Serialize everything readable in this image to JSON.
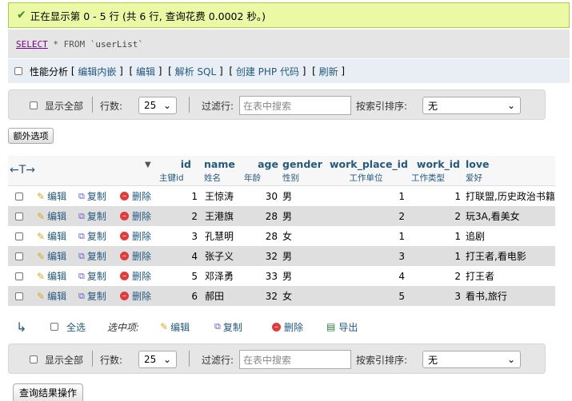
{
  "success": {
    "message": "正在显示第 0 - 5 行 (共 6 行, 查询花费 0.0002 秒。)"
  },
  "sql": {
    "select": "SELECT",
    "star": "*",
    "from": "FROM",
    "table": "`userList`"
  },
  "profiling": {
    "label": "性能分析",
    "links": [
      "编辑内嵌",
      "编辑",
      "解析 SQL",
      "创建 PHP 代码",
      "刷新"
    ]
  },
  "nav": {
    "show_all": "显示全部",
    "rows_label": "行数:",
    "rows_value": "25",
    "filter_label": "过滤行:",
    "filter_placeholder": "在表中搜索",
    "sort_label": "按索引排序:",
    "sort_value": "无"
  },
  "extra_options": "额外选项",
  "table": {
    "columns": [
      {
        "name": "id",
        "comment": "主键id"
      },
      {
        "name": "name",
        "comment": "姓名"
      },
      {
        "name": "age",
        "comment": "年龄"
      },
      {
        "name": "gender",
        "comment": "性别"
      },
      {
        "name": "work_place_id",
        "comment": "工作单位"
      },
      {
        "name": "work_id",
        "comment": "工作类型"
      },
      {
        "name": "love",
        "comment": "爱好"
      }
    ],
    "actions": {
      "edit": "编辑",
      "copy": "复制",
      "delete": "删除"
    },
    "rows": [
      {
        "id": "1",
        "name": "王惊涛",
        "age": "30",
        "gender": "男",
        "work_place_id": "1",
        "work_id": "1",
        "love": "打联盟,历史政治书籍"
      },
      {
        "id": "2",
        "name": "王港旗",
        "age": "28",
        "gender": "男",
        "work_place_id": "2",
        "work_id": "2",
        "love": "玩3A,看美女"
      },
      {
        "id": "3",
        "name": "孔慧明",
        "age": "28",
        "gender": "女",
        "work_place_id": "1",
        "work_id": "1",
        "love": "追剧"
      },
      {
        "id": "4",
        "name": "张子义",
        "age": "32",
        "gender": "男",
        "work_place_id": "3",
        "work_id": "1",
        "love": "打王者,看电影"
      },
      {
        "id": "5",
        "name": "邓泽勇",
        "age": "33",
        "gender": "男",
        "work_place_id": "4",
        "work_id": "2",
        "love": "打王者"
      },
      {
        "id": "6",
        "name": "郝田",
        "age": "32",
        "gender": "女",
        "work_place_id": "5",
        "work_id": "3",
        "love": "看书,旅行"
      }
    ]
  },
  "bulk": {
    "check_all": "全选",
    "with_selected": "选中项:",
    "edit": "编辑",
    "copy": "复制",
    "delete": "删除",
    "export": "导出"
  },
  "query_results_button": "查询结果操作"
}
